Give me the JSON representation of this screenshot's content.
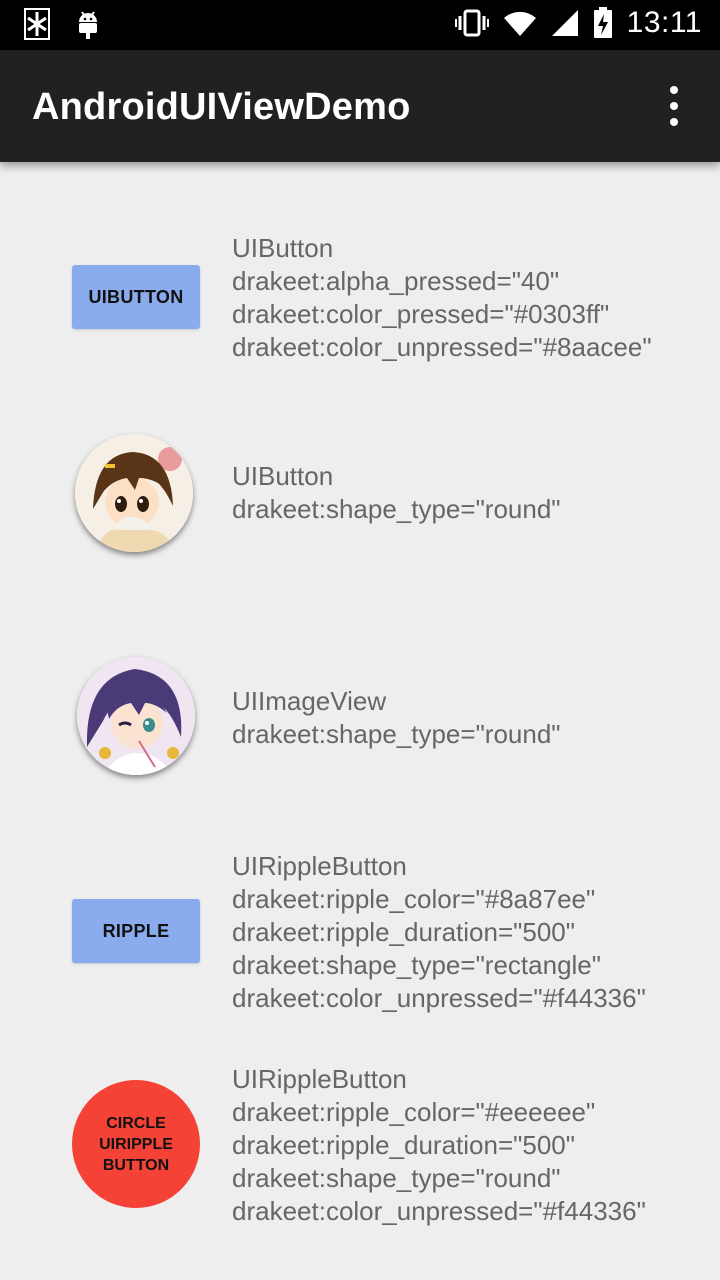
{
  "status_bar": {
    "time": "13:11",
    "left_icons": [
      "screenshot-app-icon",
      "android-debug-icon"
    ],
    "right_icons": [
      "vibrate-icon",
      "wifi-icon",
      "cell-signal-icon",
      "battery-charging-icon"
    ]
  },
  "app_bar": {
    "title": "AndroidUIViewDemo",
    "overflow_icon": "more-vert-icon"
  },
  "rows": [
    {
      "control_label": "UIBUTTON",
      "lines": [
        "UIButton",
        "drakeet:alpha_pressed=\"40\"",
        "drakeet:color_pressed=\"#0303ff\"",
        "drakeet:color_unpressed=\"#8aacee\""
      ]
    },
    {
      "control_icon": "avatar-girl-brown-hair-image",
      "lines": [
        "UIButton",
        "drakeet:shape_type=\"round\""
      ]
    },
    {
      "control_icon": "avatar-girl-purple-hair-image",
      "lines": [
        "UIImageView",
        "drakeet:shape_type=\"round\""
      ]
    },
    {
      "control_label": "RIPPLE",
      "lines": [
        "UIRippleButton",
        "drakeet:ripple_color=\"#8a87ee\"",
        "drakeet:ripple_duration=\"500\"",
        "drakeet:shape_type=\"rectangle\"",
        "drakeet:color_unpressed=\"#f44336\""
      ]
    },
    {
      "control_label_lines": [
        "CIRCLE",
        "UIRIPPLE",
        "BUTTON"
      ],
      "lines": [
        "UIRippleButton",
        "drakeet:ripple_color=\"#eeeeee\"",
        "drakeet:ripple_duration=\"500\"",
        "drakeet:shape_type=\"round\"",
        "drakeet:color_unpressed=\"#f44336\""
      ]
    }
  ],
  "colors": {
    "button_blue": "#8aacee",
    "ripple_red": "#f44336",
    "app_bar": "#212121",
    "background": "#eeeeee"
  }
}
